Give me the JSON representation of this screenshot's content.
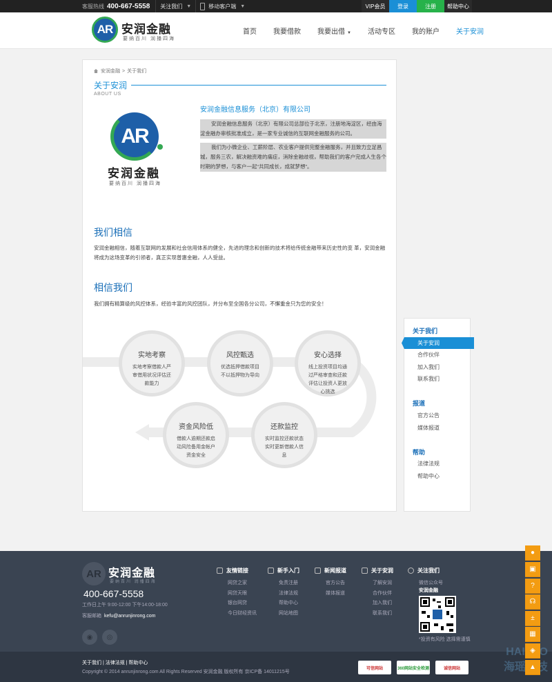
{
  "topbar": {
    "hotline_label": "客服热线",
    "hotline": "400-667-5558",
    "follow": "关注我们",
    "mobile": "移动客户端",
    "vip": "VIP会员",
    "login": "登录",
    "register": "注册",
    "help": "帮助中心"
  },
  "header": {
    "logo_mark": "AR",
    "logo_name": "安润金融",
    "logo_slogan": "要纳百川 润播四海",
    "nav": [
      {
        "label": "首页"
      },
      {
        "label": "我要借款"
      },
      {
        "label": "我要出借"
      },
      {
        "label": "活动专区"
      },
      {
        "label": "我的账户"
      },
      {
        "label": "关于安润"
      }
    ]
  },
  "breadcrumb": {
    "home": "安润金融",
    "sep": ">",
    "current": "关于我们"
  },
  "section": {
    "title": "关于安润",
    "subtitle": "ABOUT US"
  },
  "about": {
    "company": "安润金融信息服务（北京）有限公司",
    "p1": "安润金融信息服务（北京）有限公司总部位于北京，注册地海淀区，经由海淀金融办审核批准成立，是一家专业诚信的互联网金融服务的公司。",
    "p2": "我们为小微企业、工薪阶层、农业客户提供完整金融服务，并且致力立足昌城，服务三农，解决融资难的痛症，消除金融歧视，帮助我们的客户完成人生各个时期的梦想，与客户一起“共同成长，成就梦想”。"
  },
  "believe": {
    "title": "我们相信",
    "text": "安润金融相信，随着互联网的发展和社会信用体系的健全，先进的理念和创新的技术将给传统金融带来历史性的变 革，安润金融将成为这场变革的引领者，真正实现普惠金融，人人受益。"
  },
  "trust": {
    "title": "相信我们",
    "text": "我们拥有精算级的风控体系，经验丰富的风控团队，并分布至全国各分公司，不懈重金只为您的安全！"
  },
  "steps": [
    {
      "title": "实地考察",
      "desc": "实地考察借款人严审借用状况评估还款能力"
    },
    {
      "title": "风控甄选",
      "desc": "优选抵押借款项目不以抵押物为导向"
    },
    {
      "title": "安心选择",
      "desc": "线上投资项目均通过严格审查和还款评估让投资人更放心挑选"
    },
    {
      "title": "还款监控",
      "desc": "实时监控还款状态实时更新借款人信息"
    },
    {
      "title": "资金风险低",
      "desc": "借款人逾期还款启动风险备用金帐户资金安全"
    }
  ],
  "side": {
    "groups": [
      {
        "title": "关于我们",
        "items": [
          "关于安润",
          "合作伙伴",
          "加入我们",
          "联系我们"
        ]
      },
      {
        "title": "报道",
        "items": [
          "官方公告",
          "媒体报道"
        ]
      },
      {
        "title": "帮助",
        "items": [
          "法律法规",
          "帮助中心"
        ]
      }
    ]
  },
  "footer": {
    "logo_mark": "AR",
    "logo_name": "安润金融",
    "logo_slogan": "要纳百川 润播四海",
    "phone": "400-667-5558",
    "hours": "工作日上午 9:00-12:00 下午14:00-18:00",
    "email_label": "客服邮箱",
    "email": "kefu@anrunjinrong.com",
    "cols": [
      {
        "title": "友情链接",
        "links": [
          "网贷之家",
          "网贷天眼",
          "银台网贷",
          "今日财经资讯"
        ]
      },
      {
        "title": "新手入门",
        "links": [
          "免责注册",
          "法律法规",
          "帮助中心",
          "网站地图"
        ]
      },
      {
        "title": "新闻报道",
        "links": [
          "官方公告",
          "媒体报道"
        ]
      },
      {
        "title": "关于安润",
        "links": [
          "了解安润",
          "合作伙伴",
          "加入我们",
          "联系我们"
        ]
      },
      {
        "title": "关注我们",
        "links": []
      }
    ],
    "wechat_label": "微信公众号",
    "wechat_name": "安润金融",
    "qr_caption": "*投资有风险 选择需谨慎"
  },
  "bottom": {
    "links": "关于我们 | 法律法规 | 帮助中心",
    "copyright": "Copyright © 2014 anrunjinrong.com All Rights Reserved 安润金融 版权所有 京ICP备 14011215号",
    "badges": [
      "可信网站",
      "360网站安全检测",
      "诚信网站"
    ],
    "watermark_top": "HAIYAO",
    "watermark_bottom": "海瑶科技"
  },
  "colors": {
    "accent": "#1a8fd6",
    "green": "#27b24a",
    "footer": "#3a4452",
    "float": "#f39c12"
  }
}
